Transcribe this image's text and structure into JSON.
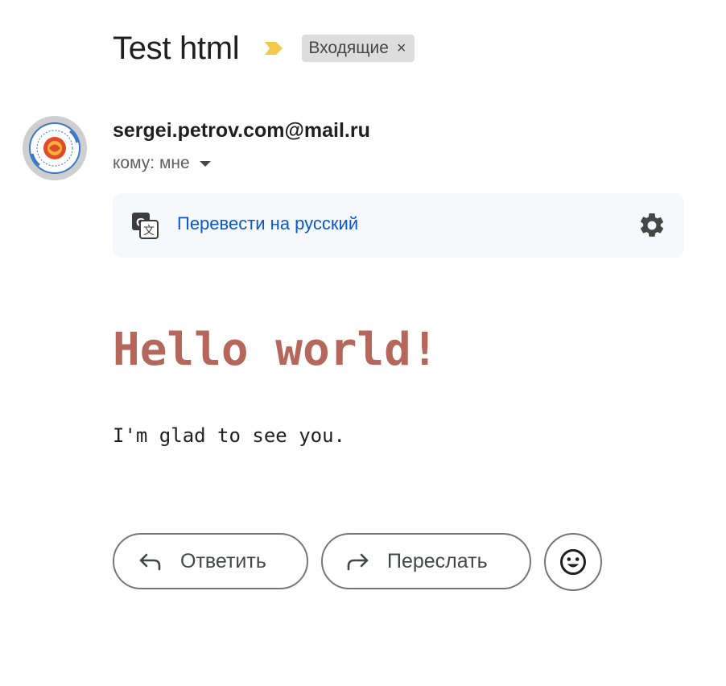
{
  "email": {
    "subject": "Test html",
    "label": "Входящие",
    "label_remove": "×",
    "sender": "sergei.petrov.com@mail.ru",
    "recipient": "кому: мне"
  },
  "translate": {
    "link_label": "Перевести на русский"
  },
  "body": {
    "heading": "Hello world!",
    "text": "I'm glad to see you."
  },
  "actions": {
    "reply_label": "Ответить",
    "forward_label": "Переслать"
  },
  "colors": {
    "importance_marker": "#f2c94c",
    "heading": "#b5675b",
    "link": "#0b57d0",
    "avatar_bg": "#cfcfcf"
  },
  "icons": {
    "importance": "importance-marker-icon",
    "translate": "translate-icon",
    "settings": "gear-icon",
    "reply": "reply-arrow-icon",
    "forward": "forward-arrow-icon",
    "emoji": "smiley-icon",
    "dropdown": "caret-down-icon"
  }
}
